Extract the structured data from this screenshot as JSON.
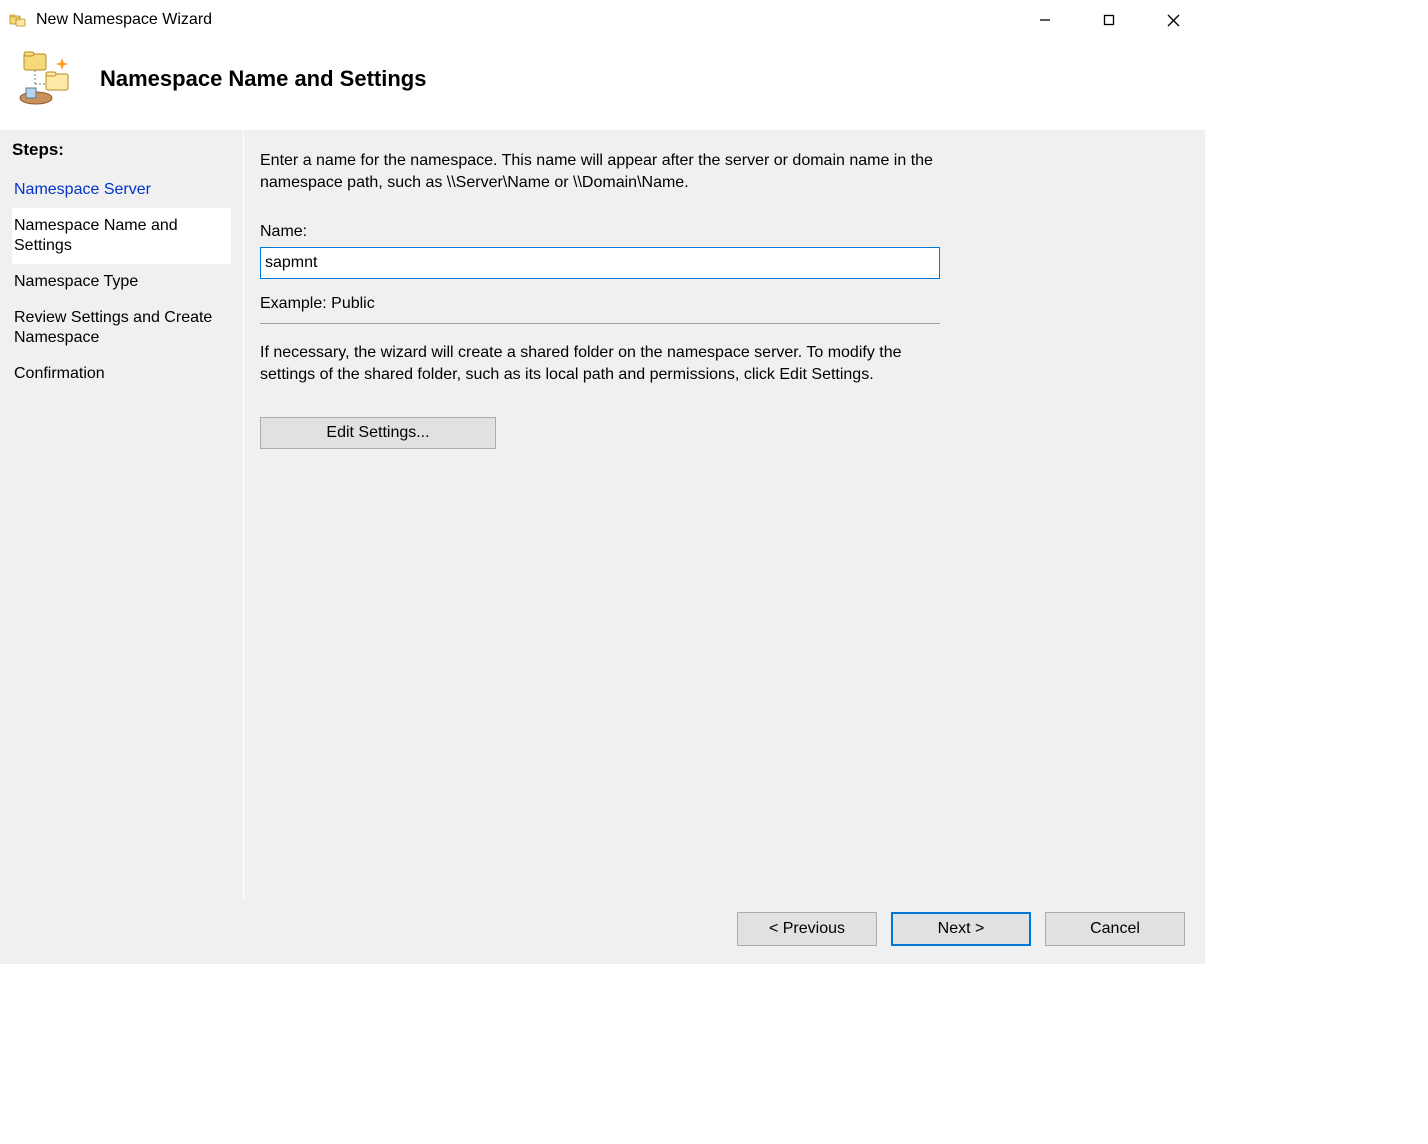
{
  "window": {
    "title": "New Namespace Wizard"
  },
  "header": {
    "title": "Namespace Name and Settings"
  },
  "sidebar": {
    "label": "Steps:",
    "steps": [
      {
        "label": "Namespace Server"
      },
      {
        "label": "Namespace Name and Settings"
      },
      {
        "label": "Namespace Type"
      },
      {
        "label": "Review Settings and Create Namespace"
      },
      {
        "label": "Confirmation"
      }
    ]
  },
  "main": {
    "description": "Enter a name for the namespace. This name will appear after the server or domain name in the namespace path, such as \\\\Server\\Name or \\\\Domain\\Name.",
    "nameLabel": "Name:",
    "nameValue": "sapmnt",
    "example": "Example: Public",
    "hint": "If necessary, the wizard will create a shared folder on the namespace server. To modify the settings of the shared folder, such as its local path and permissions, click Edit Settings.",
    "editButton": "Edit Settings..."
  },
  "footer": {
    "previous": "< Previous",
    "next": "Next >",
    "cancel": "Cancel"
  }
}
